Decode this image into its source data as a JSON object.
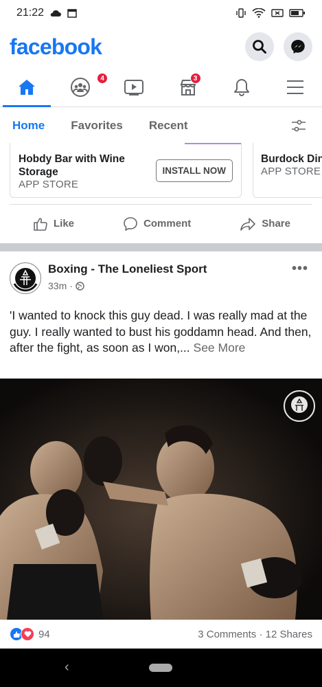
{
  "status_bar": {
    "time": "21:22"
  },
  "header": {
    "logo": "facebook"
  },
  "nav_tabs": [
    {
      "name": "home",
      "badge": ""
    },
    {
      "name": "groups",
      "badge": "4"
    },
    {
      "name": "watch",
      "badge": ""
    },
    {
      "name": "marketplace",
      "badge": "3"
    },
    {
      "name": "notifications",
      "badge": ""
    },
    {
      "name": "menu",
      "badge": ""
    }
  ],
  "sub_tabs": {
    "home": "Home",
    "favorites": "Favorites",
    "recent": "Recent"
  },
  "carousel": {
    "card1": {
      "title": "Hobdy Bar with Wine Storage",
      "source": "APP STORE",
      "button": "INSTALL NOW"
    },
    "card2": {
      "title": "Burdock Dining",
      "source": "APP STORE"
    }
  },
  "actions": {
    "like": "Like",
    "comment": "Comment",
    "share": "Share"
  },
  "post": {
    "page_name": "Boxing - The Loneliest Sport",
    "time": "33m",
    "separator": "·",
    "text": "'I wanted to knock this guy dead. I was really mad at the guy. I really wanted to bust his goddamn head. And then, after the fight, as soon as I won,...",
    "see_more": "See More",
    "watermark": "THE LONELIEST SPORT",
    "reaction_count": "94",
    "comments": "3 Comments",
    "dot": "·",
    "shares": "12 Shares"
  },
  "colors": {
    "brand": "#1877f2",
    "badge": "#e41e3f",
    "secondary_text": "#65676b"
  }
}
